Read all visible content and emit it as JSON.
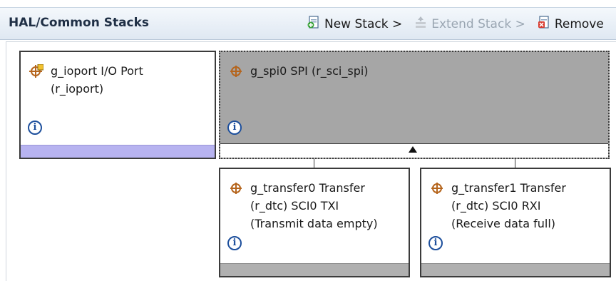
{
  "panel": {
    "title": "HAL/Common Stacks"
  },
  "toolbar": {
    "new_stack": "New Stack >",
    "extend_stack": "Extend Stack >",
    "remove": "Remove"
  },
  "stacks": {
    "ioport": {
      "line1": "g_ioport I/O Port",
      "line2": "(r_ioport)",
      "info": "i"
    },
    "spi": {
      "line1": "g_spi0 SPI (r_sci_spi)",
      "info": "i"
    },
    "transfer0": {
      "line1": "g_transfer0 Transfer",
      "line2": "(r_dtc) SCI0 TXI",
      "line3": "(Transmit data empty)",
      "info": "i"
    },
    "transfer1": {
      "line1": "g_transfer1 Transfer",
      "line2": "(r_dtc) SCI0 RXI",
      "line3": "(Receive data full)",
      "info": "i"
    }
  },
  "colors": {
    "header_bg": "#dfe8f2",
    "ioport_bar": "#b7b3f0",
    "spi_bg": "#a6a6a6",
    "transfer_bar": "#b0b0b0",
    "info_icon": "#1d4f9c"
  },
  "icons": {
    "new_stack": "new-stack-icon",
    "extend_stack": "extend-stack-icon",
    "remove": "remove-icon",
    "ioport": "module-icon-with-badge",
    "module": "module-icon",
    "info": "info-icon"
  }
}
